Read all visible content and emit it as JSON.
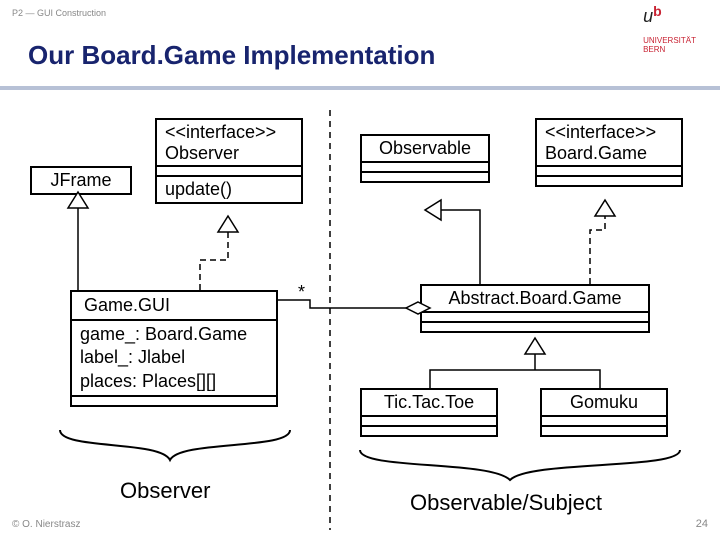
{
  "breadcrumb": "P2 — GUI Construction",
  "title": "Our Board.Game Implementation",
  "logo": {
    "u": "u",
    "b": "b",
    "line1": "UNIVERSITÄT",
    "line2": "BERN"
  },
  "boxes": {
    "jframe": {
      "name": "JFrame"
    },
    "observer_iface": {
      "stereo": "<<interface>>",
      "name": "Observer",
      "op": "update()"
    },
    "observable": {
      "name": "Observable"
    },
    "boardgame_iface": {
      "stereo": "<<interface>>",
      "name": "Board.Game"
    },
    "gamegui": {
      "name": "Game.GUI",
      "attr1": "game_: Board.Game",
      "attr2": "label_: Jlabel",
      "attr3": "places: Places[][]"
    },
    "abstract_bg": {
      "name": "Abstract.Board.Game"
    },
    "tictactoe": {
      "name": "Tic.Tac.Toe"
    },
    "gomuku": {
      "name": "Gomuku"
    }
  },
  "multiplicity": "*",
  "group_observer": "Observer",
  "group_subject": "Observable/Subject",
  "footer": "© O. Nierstrasz",
  "page": "24"
}
